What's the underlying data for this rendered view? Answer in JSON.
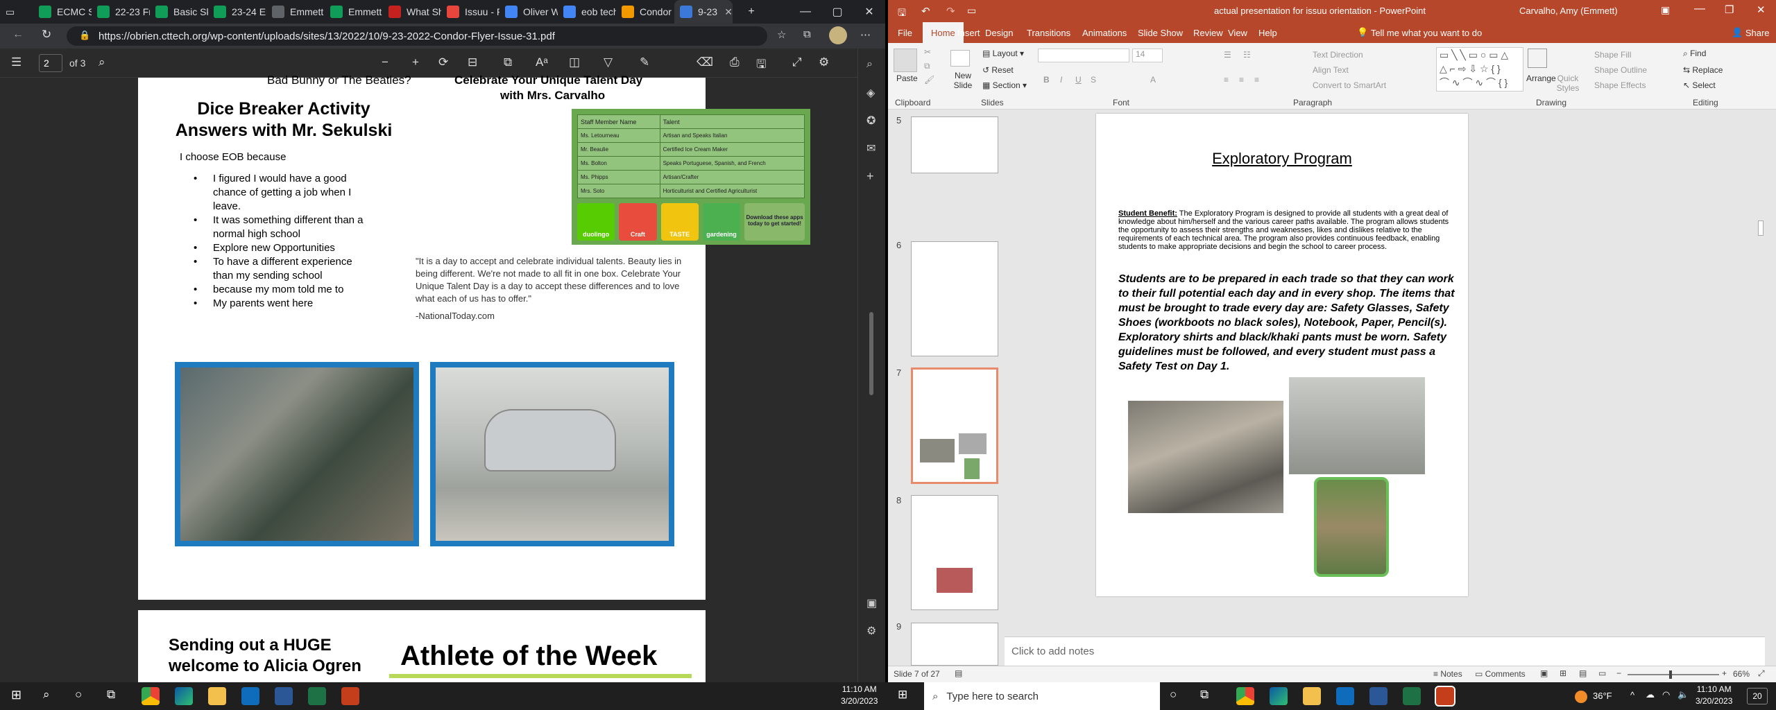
{
  "browser": {
    "tabs": [
      {
        "label": "ECMC St",
        "color": "#0f9d58"
      },
      {
        "label": "22-23 Fr",
        "color": "#0f9d58"
      },
      {
        "label": "Basic Ski",
        "color": "#0f9d58"
      },
      {
        "label": "23-24 Er",
        "color": "#0f9d58"
      },
      {
        "label": "Emmett",
        "color": "#5f6368"
      },
      {
        "label": "Emmett",
        "color": "#0f9d58"
      },
      {
        "label": "What Sh",
        "color": "#c5221f"
      },
      {
        "label": "Issuu - P",
        "color": "#e8453c"
      },
      {
        "label": "Oliver W",
        "color": "#4285f4"
      },
      {
        "label": "eob tech",
        "color": "#4285f4"
      },
      {
        "label": "Condor I",
        "color": "#f29900"
      },
      {
        "label": "9-23",
        "color": "#3c78d8"
      }
    ],
    "url": "https://obrien.cttech.org/wp-content/uploads/sites/13/2022/10/9-23-2022-Condor-Flyer-Issue-31.pdf",
    "page_current": "2",
    "page_total": "of 3"
  },
  "pdf": {
    "top_cut_left": "Bad Bunny or The Beatles?",
    "top_cut_right": "Celebrate Your Unique Talent Day",
    "talent_with": "with Mrs. Carvalho",
    "dice_title": "Dice Breaker Activity Answers with Mr. Sekulski",
    "choose_eob": "I choose EOB because",
    "reasons": [
      "I figured I would have a good chance of getting a job when I leave.",
      "It was something different than a normal high school",
      "Explore new Opportunities",
      "To have a different experience than my sending school",
      "because my mom told me to",
      "My parents went here"
    ],
    "table_header": [
      "Staff Member Name",
      "Talent"
    ],
    "table_rows": [
      [
        "Ms. Letourneau",
        "Artisan and Speaks Italian"
      ],
      [
        "Mr. Beaulie",
        "Certified Ice Cream Maker"
      ],
      [
        "Ms. Bolton",
        "Speaks Portuguese, Spanish, and French"
      ],
      [
        "Ms. Phipps",
        "Artisan/Crafter"
      ],
      [
        "Mrs. Soto",
        "Horticulturist and Certified Agriculturist"
      ]
    ],
    "apps": [
      "duolingo",
      "Craft",
      "TASTE",
      "gardening",
      "Download these apps today to get started!"
    ],
    "quote": "\"It is a day to accept and celebrate individual talents. Beauty lies in being different. We're not made to all fit in one box. Celebrate Your Unique Talent Day is a day to accept these differences and to love what each of us has to offer.\"",
    "quote_source": "-NationalToday.com",
    "page2_left": "Sending out a HUGE welcome to Alicia Ogren",
    "page2_right": "Athlete of the Week"
  },
  "ppt": {
    "window_title": "actual presentation for issuu orientation  -  PowerPoint",
    "user": "Carvalho, Amy (Emmett)",
    "ribbon_tabs": [
      "File",
      "Home",
      "Insert",
      "Design",
      "Transitions",
      "Animations",
      "Slide Show",
      "Review",
      "View",
      "Help"
    ],
    "tell_me": "Tell me what you want to do",
    "share": "Share",
    "clipboard": {
      "paste": "Paste",
      "group": "Clipboard"
    },
    "slides_group": {
      "new_slide": "New Slide",
      "layout": "Layout",
      "reset": "Reset",
      "section": "Section",
      "group": "Slides"
    },
    "font_group": {
      "font_size": "14",
      "group": "Font"
    },
    "paragraph_group": {
      "text_direction": "Text Direction",
      "align_text": "Align Text",
      "convert": "Convert to SmartArt",
      "group": "Paragraph"
    },
    "drawing_group": {
      "arrange": "Arrange",
      "quick_styles": "Quick Styles",
      "shape_fill": "Shape Fill",
      "shape_outline": "Shape Outline",
      "shape_effects": "Shape Effects",
      "group": "Drawing"
    },
    "editing_group": {
      "find": "Find",
      "replace": "Replace",
      "select": "Select",
      "group": "Editing"
    },
    "thumb_numbers": [
      "5",
      "6",
      "7",
      "8",
      "9"
    ],
    "slide_title": "Exploratory Program",
    "student_benefit_label": "Student Benefit:",
    "student_benefit_text": " The Exploratory Program is designed to provide all students with a great deal of knowledge  about him/herself and the various career paths available. The program allows students the opportunity to  assess their strengths and weaknesses, likes and dislikes relative to the requirements of each technical area.  The program also provides continuous feedback, enabling students to make appropriate decisions and begin  the school to career process.",
    "slide_italic": "Students are to be prepared in each trade so that they can work to their full potential each day and in every  shop. The items that must be brought to trade every day are: Safety Glasses, Safety Shoes (workboots no black soles),  Notebook, Paper, Pencil(s). Exploratory shirts and black/khaki pants must be worn. Safety guidelines must be followed, and every student must pass a Safety Test on Day 1.",
    "notes_placeholder": "Click to add notes",
    "status_slide": "Slide 7 of 27",
    "status_notes": "Notes",
    "status_comments": "Comments",
    "zoom": "66%"
  },
  "taskbar": {
    "search_placeholder": "Type here to search",
    "weather": "36°F",
    "clock_left": {
      "time": "11:10 AM",
      "date": "3/20/2023"
    },
    "clock_right": {
      "time": "11:10 AM",
      "date": "3/20/2023"
    },
    "notif_count": "20"
  }
}
